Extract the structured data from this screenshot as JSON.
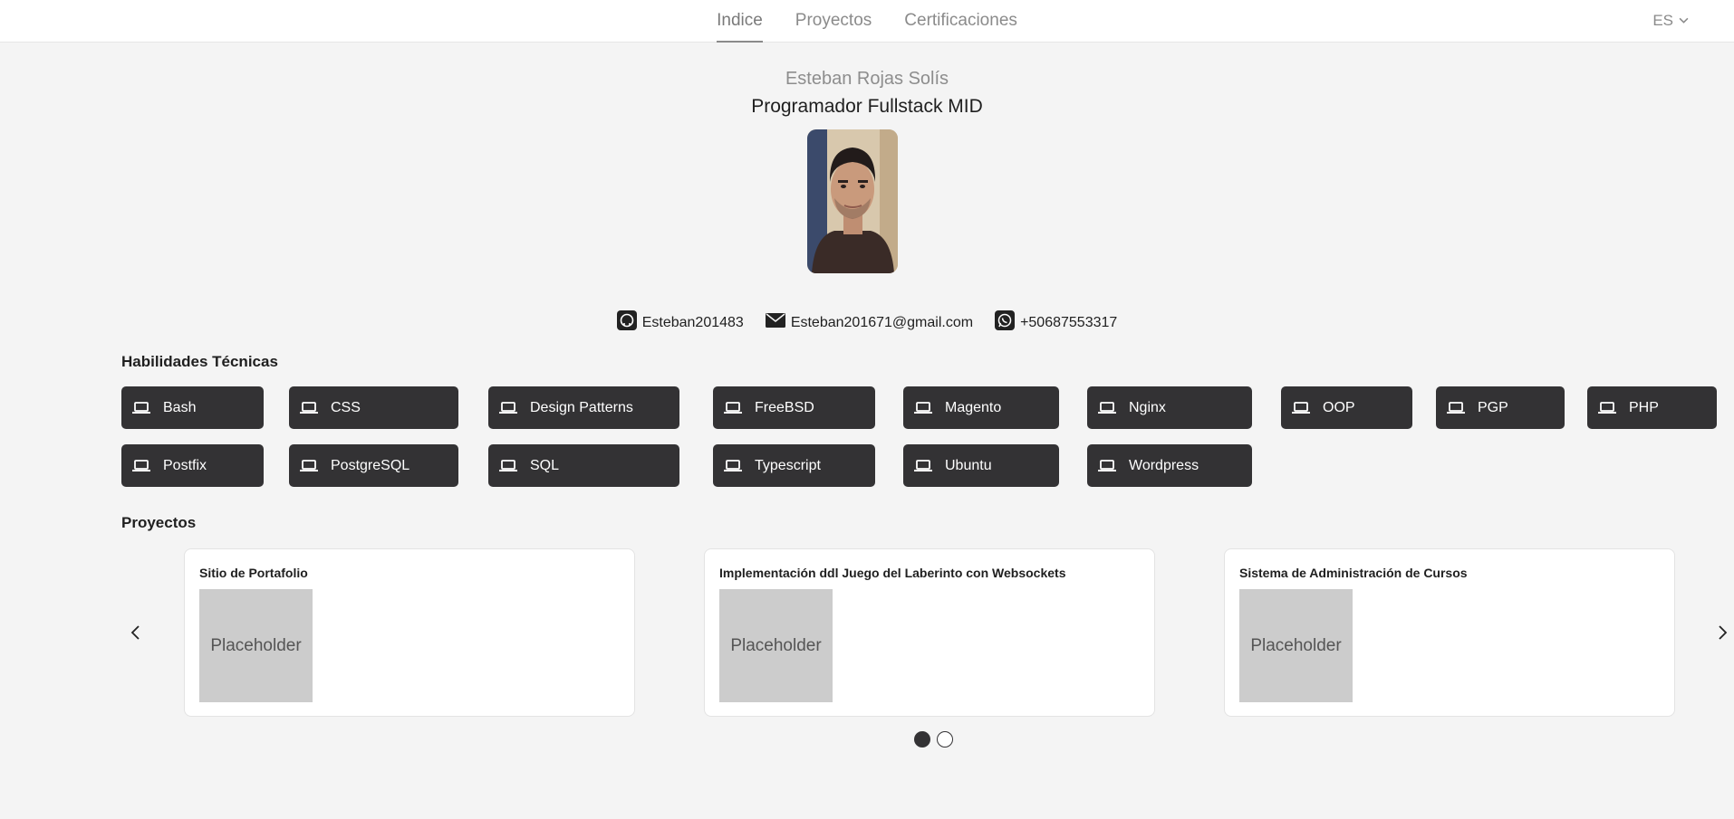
{
  "nav": {
    "tabs": [
      {
        "label": "Indice",
        "active": true
      },
      {
        "label": "Proyectos",
        "active": false
      },
      {
        "label": "Certificaciones",
        "active": false
      }
    ],
    "language": "ES",
    "language_icon": "chevron-down-icon"
  },
  "profile": {
    "name": "Esteban Rojas Solís",
    "role": "Programador Fullstack MID"
  },
  "contacts": {
    "github": {
      "label": "Esteban201483",
      "icon": "github-icon"
    },
    "email": {
      "label": "Esteban201671@gmail.com",
      "icon": "envelope-icon"
    },
    "whatsapp": {
      "label": "+50687553317",
      "icon": "whatsapp-icon"
    }
  },
  "skills": {
    "title": "Habilidades Técnicas",
    "icon": "laptop-icon",
    "items": [
      "Bash",
      "CSS",
      "Design Patterns",
      "FreeBSD",
      "Magento",
      "Nginx",
      "OOP",
      "PGP",
      "PHP",
      "Postfix",
      "PostgreSQL",
      "SQL",
      "Typescript",
      "Ubuntu",
      "Wordpress"
    ]
  },
  "projects": {
    "title": "Proyectos",
    "cards": [
      {
        "title": "Sitio de Portafolio",
        "image_text": "Placeholder"
      },
      {
        "title": "Implementación ddl Juego del Laberinto con Websockets",
        "image_text": "Placeholder"
      },
      {
        "title": "Sistema de Administración de Cursos",
        "image_text": "Placeholder"
      }
    ],
    "pages": 2,
    "current_page": 1
  },
  "colors": {
    "accent_dark": "#333234",
    "background": "#f4f4f4",
    "muted_text": "#8d8d8d"
  }
}
